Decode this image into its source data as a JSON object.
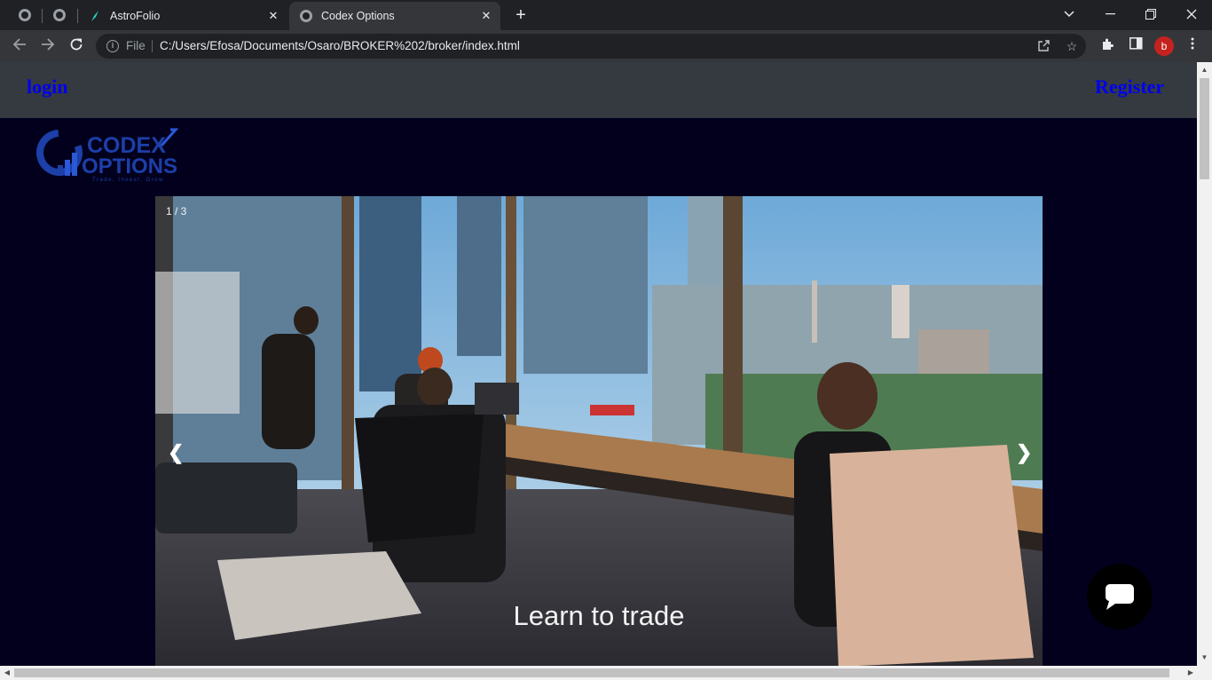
{
  "browser": {
    "tabs": [
      {
        "title": "AstroFolio"
      },
      {
        "title": "Codex Options"
      }
    ],
    "address": {
      "scheme_label": "File",
      "url": "C:/Users/Efosa/Documents/Osaro/BROKER%202/broker/index.html"
    },
    "profile_initial": "b"
  },
  "page": {
    "nav": {
      "login_label": "login",
      "register_label": "Register"
    },
    "logo": {
      "line1": "CODEX",
      "line2": "OPTIONS",
      "tagline": "Trade. Invest. Grow"
    },
    "slideshow": {
      "counter": "1 / 3",
      "prev_glyph": "❮",
      "next_glyph": "❯",
      "caption": "Learn to trade"
    }
  },
  "colors": {
    "page_background": "#03001e",
    "nav_background": "#343a40",
    "link": "#0000ee",
    "logo_blue": "#1c3fa8"
  }
}
